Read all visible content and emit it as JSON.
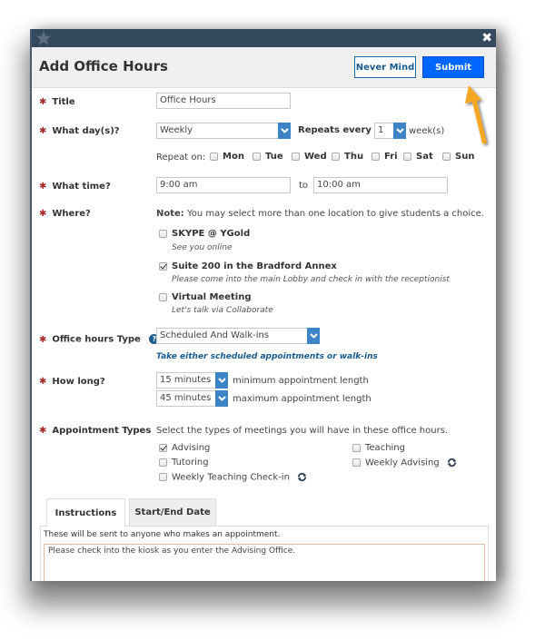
{
  "dialog": {
    "title": "Add Office Hours",
    "buttons": {
      "never_mind": "Never Mind",
      "submit": "Submit"
    },
    "close_icon": "close-icon",
    "logo_icon": "star-logo-icon"
  },
  "form": {
    "title": {
      "label": "Title",
      "value": "Office Hours"
    },
    "days": {
      "label": "What day(s)?",
      "frequency": "Weekly",
      "repeats_every_label": "Repeats every",
      "repeats_every_value": "1",
      "repeats_unit": "week(s)",
      "repeat_on_label": "Repeat on:",
      "weekdays": [
        {
          "label": "Mon",
          "checked": false
        },
        {
          "label": "Tue",
          "checked": false
        },
        {
          "label": "Wed",
          "checked": false
        },
        {
          "label": "Thu",
          "checked": false
        },
        {
          "label": "Fri",
          "checked": false
        },
        {
          "label": "Sat",
          "checked": false
        },
        {
          "label": "Sun",
          "checked": false
        }
      ]
    },
    "time": {
      "label": "What time?",
      "start": "9:00 am",
      "to": "to",
      "end": "10:00 am"
    },
    "where": {
      "label": "Where?",
      "note_bold": "Note:",
      "note_text": " You may select more than one location to give students a choice.",
      "locations": [
        {
          "name": "SKYPE @ YGold",
          "desc": "See you online",
          "checked": false
        },
        {
          "name": "Suite 200 in the Bradford Annex",
          "desc": "Please come into the main Lobby and check in with the receptionist",
          "checked": true
        },
        {
          "name": "Virtual Meeting",
          "desc": "Let's talk via Collaborate",
          "checked": false
        }
      ]
    },
    "office_hours_type": {
      "label": "Office hours Type",
      "value": "Scheduled And Walk-ins",
      "hint": "Take either scheduled appointments or walk-ins"
    },
    "how_long": {
      "label": "How long?",
      "min_value": "15 minutes",
      "min_label": "minimum appointment length",
      "max_value": "45 minutes",
      "max_label": "maximum appointment length"
    },
    "appointment_types": {
      "label": "Appointment Types",
      "intro": "Select the types of meetings you will have in these office hours.",
      "items": [
        {
          "label": "Advising",
          "checked": true,
          "recurring": false
        },
        {
          "label": "Teaching",
          "checked": false,
          "recurring": false
        },
        {
          "label": "Tutoring",
          "checked": false,
          "recurring": false
        },
        {
          "label": "Weekly Advising",
          "checked": false,
          "recurring": true
        },
        {
          "label": "Weekly Teaching Check-in",
          "checked": false,
          "recurring": true
        }
      ]
    }
  },
  "tabs": [
    {
      "label": "Instructions",
      "active": true
    },
    {
      "label": "Start/End Date",
      "active": false
    }
  ],
  "instructions": {
    "help_text": "These will be sent to anyone who makes an appointment.",
    "value": "Please check into the kiosk as you enter the Advising Office."
  },
  "colors": {
    "titlebar": "#34495e",
    "submit": "#0066ff",
    "required_star": "#a52a2a",
    "hint": "#1a5b8e",
    "select_arrow": "#3d84c6",
    "annotation_arrow": "#f5a623"
  }
}
